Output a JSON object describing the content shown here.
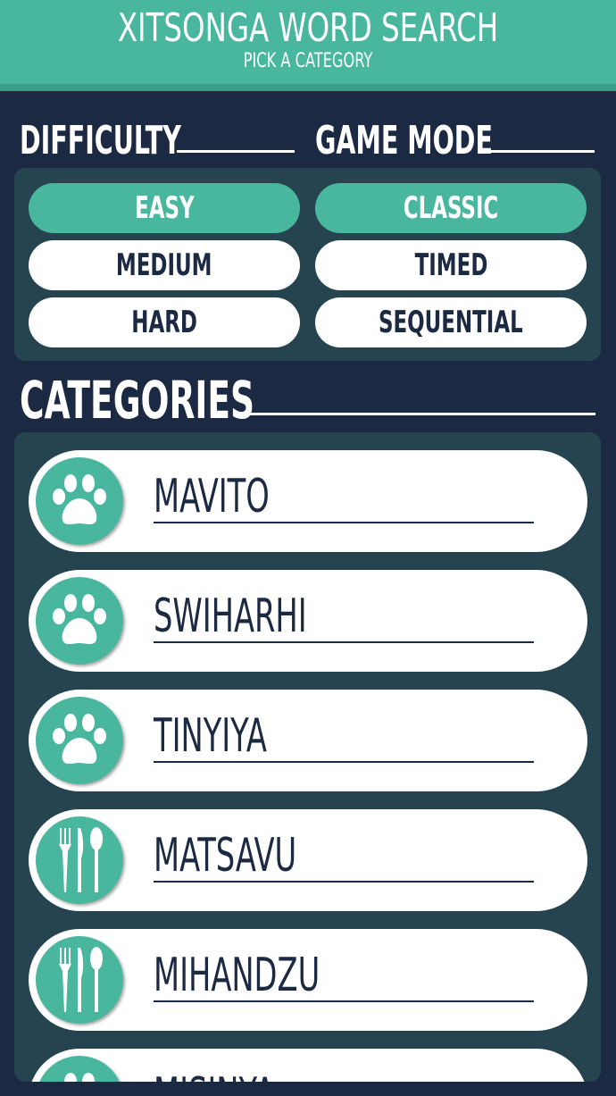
{
  "header": {
    "title": "XITSONGA WORD SEARCH",
    "subtitle": "PICK A CATEGORY"
  },
  "difficulty": {
    "heading": "DIFFICULTY",
    "options": [
      "EASY",
      "MEDIUM",
      "HARD"
    ],
    "selected": "EASY"
  },
  "game_mode": {
    "heading": "GAME MODE",
    "options": [
      "CLASSIC",
      "TIMED",
      "SEQUENTIAL"
    ],
    "selected": "CLASSIC"
  },
  "categories": {
    "heading": "CATEGORIES",
    "items": [
      {
        "label": "MAVITO",
        "icon": "paw-icon"
      },
      {
        "label": "SWIHARHI",
        "icon": "paw-icon"
      },
      {
        "label": "TINYIYA",
        "icon": "paw-icon"
      },
      {
        "label": "MATSAVU",
        "icon": "cutlery-icon"
      },
      {
        "label": "MIHANDZU",
        "icon": "cutlery-icon"
      },
      {
        "label": "MISINYA",
        "icon": "paw-icon"
      }
    ]
  },
  "colors": {
    "background": "#1b2942",
    "panel": "#254450",
    "accent": "#49b79e",
    "white": "#ffffff"
  }
}
